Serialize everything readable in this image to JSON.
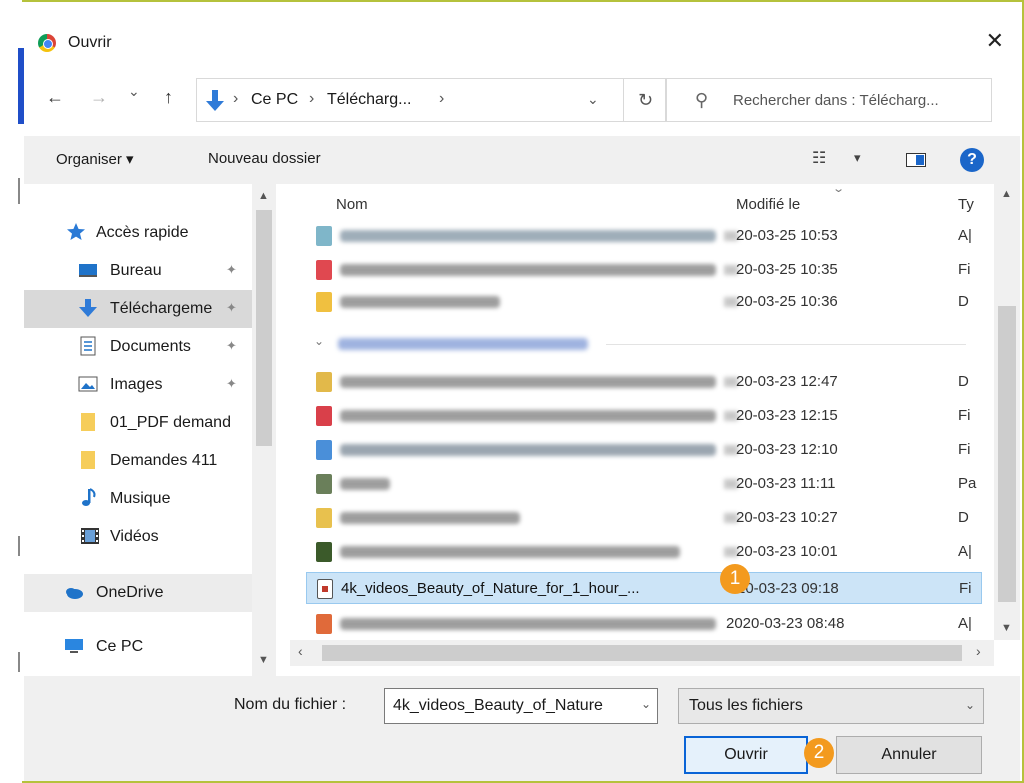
{
  "window": {
    "title": "Ouvrir",
    "close": "✕"
  },
  "nav": {
    "back": "←",
    "forward": "→",
    "recent": "⌄",
    "up": "↑",
    "breadcrumb": [
      "Ce PC",
      "Télécharg..."
    ],
    "breadcrumb_sep": "›",
    "refresh": "↻",
    "search_placeholder": "Rechercher dans : Télécharg..."
  },
  "toolbar": {
    "organize": "Organiser ▾",
    "new_folder": "Nouveau dossier",
    "view_menu": "▾",
    "help": "?"
  },
  "sidebar": {
    "items": [
      {
        "label": "Accès rapide",
        "icon": "star-icon"
      },
      {
        "label": "Bureau",
        "icon": "desktop-icon",
        "pinned": true
      },
      {
        "label": "Téléchargeme",
        "icon": "download-icon",
        "pinned": true,
        "selected": true
      },
      {
        "label": "Documents",
        "icon": "document-icon",
        "pinned": true
      },
      {
        "label": "Images",
        "icon": "image-icon",
        "pinned": true
      },
      {
        "label": "01_PDF demand",
        "icon": "folder-icon"
      },
      {
        "label": "Demandes 411",
        "icon": "folder-icon"
      },
      {
        "label": "Musique",
        "icon": "music-icon"
      },
      {
        "label": "Vidéos",
        "icon": "video-icon"
      },
      {
        "label": "OneDrive",
        "icon": "cloud-icon"
      },
      {
        "label": "Ce PC",
        "icon": "computer-icon"
      }
    ],
    "pin": "📌"
  },
  "filelist": {
    "columns": {
      "name": "Nom",
      "modified": "Modifié le",
      "type": "Ty"
    },
    "rows_top": [
      {
        "date": "20-03-25 10:53",
        "type": "A|",
        "color": "#7fb6c9"
      },
      {
        "date": "20-03-25 10:35",
        "type": "Fi",
        "color": "#e04850"
      },
      {
        "date": "20-03-25 10:36",
        "type": "D",
        "color": "#f0c040"
      }
    ],
    "rows_bottom": [
      {
        "date": "20-03-23 12:47",
        "type": "D",
        "color": "#e2b94a"
      },
      {
        "date": "20-03-23 12:15",
        "type": "Fi",
        "color": "#d9404a"
      },
      {
        "date": "20-03-23 12:10",
        "type": "Fi",
        "color": "#4a8fd9"
      },
      {
        "date": "20-03-23 11:11",
        "type": "Pa",
        "color": "#6a7f5a"
      },
      {
        "date": "20-03-23 10:27",
        "type": "D",
        "color": "#e8c14e"
      },
      {
        "date": "20-03-23 10:01",
        "type": "A|",
        "color": "#3b5a2a"
      }
    ],
    "selected_row": {
      "name": "4k_videos_Beauty_of_Nature_for_1_hour_...",
      "date": "20-03-23 09:18",
      "type": "Fi"
    },
    "last_row": {
      "date": "2020-03-23 08:48",
      "type": "A|",
      "color": "#e06a3a"
    }
  },
  "bottom": {
    "filename_label": "Nom du fichier :",
    "filename_value": "4k_videos_Beauty_of_Nature",
    "filter_value": "Tous les fichiers",
    "open_button": "Ouvrir",
    "cancel_button": "Annuler"
  },
  "badges": {
    "one": "1",
    "two": "2"
  },
  "colors": {
    "accent": "#0a64d6",
    "badge": "#f39a1e",
    "frame": "#b5c23c"
  }
}
